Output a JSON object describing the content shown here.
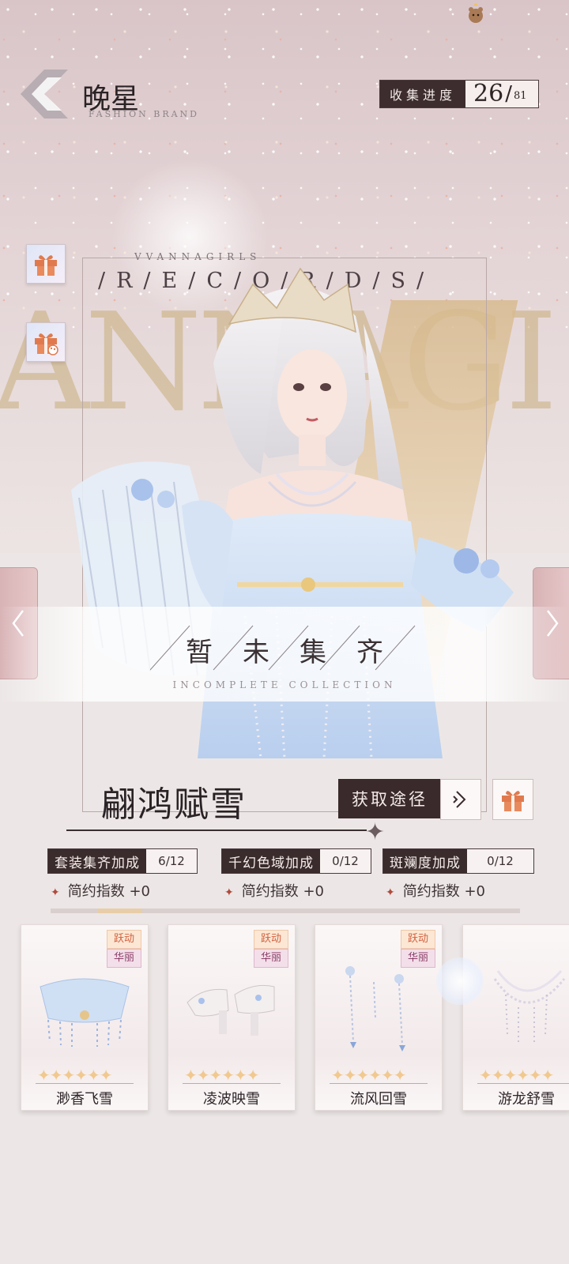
{
  "header": {
    "brand_title": "晚星",
    "brand_subtitle": "FASHION BRAND",
    "progress_label": "收集进度",
    "progress_count": "26",
    "progress_total": "81"
  },
  "backdrop": {
    "records_text": "/R/E/C/O/R/D/S/",
    "brand_watermark": "VVANNAGIRLS",
    "big_letters": "ANNAGI"
  },
  "banner": {
    "title": "暂未集齐",
    "subtitle": "INCOMPLETE COLLECTION"
  },
  "set": {
    "name": "翩鸿赋雪",
    "obtain_label": "获取途径"
  },
  "bonuses": [
    {
      "label": "套装集齐加成",
      "value": "6/12",
      "effect": "简约指数 +0"
    },
    {
      "label": "千幻色域加成",
      "value": "0/12",
      "effect": "简约指数 +0"
    },
    {
      "label": "斑斓度加成",
      "value": "0/12",
      "effect": "简约指数 +0"
    }
  ],
  "items": [
    {
      "name": "渺香飞雪",
      "tag1": "跃动",
      "tag2": "华丽",
      "stars": "✦✦✦✦✦✦"
    },
    {
      "name": "凌波映雪",
      "tag1": "跃动",
      "tag2": "华丽",
      "stars": "✦✦✦✦✦✦"
    },
    {
      "name": "流风回雪",
      "tag1": "跃动",
      "tag2": "华丽",
      "stars": "✦✦✦✦✦✦"
    },
    {
      "name": "游龙舒雪",
      "tag1": "",
      "tag2": "",
      "stars": "✦✦✦✦✦✦"
    }
  ],
  "icons": {
    "back": "back-arrow-icon",
    "gift": "gift-icon",
    "gift_palette": "gift-palette-icon",
    "prev": "chevron-left-icon",
    "next": "chevron-right-icon",
    "obtain_arrow": "chevron-double-right-icon",
    "mascot": "bear-icon"
  },
  "colors": {
    "accent_dark": "#3a2a2c",
    "gift_orange": "#e07a4e",
    "nav_pink": "#d8b3b6",
    "star_gold": "#f1c88e"
  }
}
